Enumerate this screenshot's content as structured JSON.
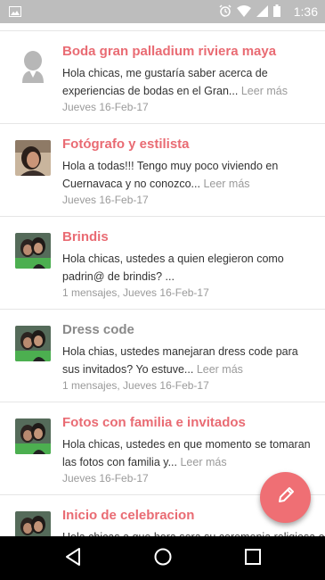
{
  "status": {
    "time": "1:36",
    "icons": [
      "gallery-icon",
      "alarm-icon",
      "wifi-icon",
      "signal-icon",
      "battery-icon"
    ]
  },
  "threads": [
    {
      "title": "Boda gran palladium riviera maya",
      "snippet": "Hola chicas, me gustaría saber acerca de experiencias de bodas en el Gran...",
      "more": "Leer más",
      "meta": "Jueves 16-Feb-17",
      "avatar": "default-avatar",
      "read": false
    },
    {
      "title": "Fotógrafo y estilista",
      "snippet": "Hola a todas!!! Tengo muy poco viviendo en Cuernavaca y no conozco...",
      "more": "Leer más",
      "meta": "Jueves 16-Feb-17",
      "avatar": "photo-woman",
      "read": false
    },
    {
      "title": "Brindis",
      "snippet": "Hola chicas, ustedes a quien elegieron como padrin@ de brindis? ...",
      "more": "",
      "meta": "1 mensajes, Jueves 16-Feb-17",
      "avatar": "photo-couple",
      "read": false
    },
    {
      "title": "Dress code",
      "snippet": "Hola chias, ustedes manejaran dress code para sus invitados? Yo estuve...",
      "more": "Leer más",
      "meta": "1 mensajes, Jueves 16-Feb-17",
      "avatar": "photo-couple",
      "read": true
    },
    {
      "title": "Fotos con familia e invitados",
      "snippet": "Hola chicas, ustedes en que momento se tomaran las fotos con familia y...",
      "more": "Leer más",
      "meta": "Jueves 16-Feb-17",
      "avatar": "photo-couple",
      "read": false
    },
    {
      "title": "Inicio de celebracion",
      "snippet": "Hola chicas a que hora sera su ceremonia religiosa o",
      "more": "",
      "meta": "",
      "avatar": "photo-couple",
      "read": false
    }
  ],
  "fab": {
    "icon": "pencil-icon",
    "color": "#ef6f74"
  },
  "nav": {
    "buttons": [
      "back-icon",
      "home-icon",
      "recents-icon"
    ]
  },
  "colors": {
    "accent": "#e96b73",
    "read_title": "#8a8a8a",
    "meta": "#9a9a9a",
    "statusbar": "#bdbdbd"
  }
}
